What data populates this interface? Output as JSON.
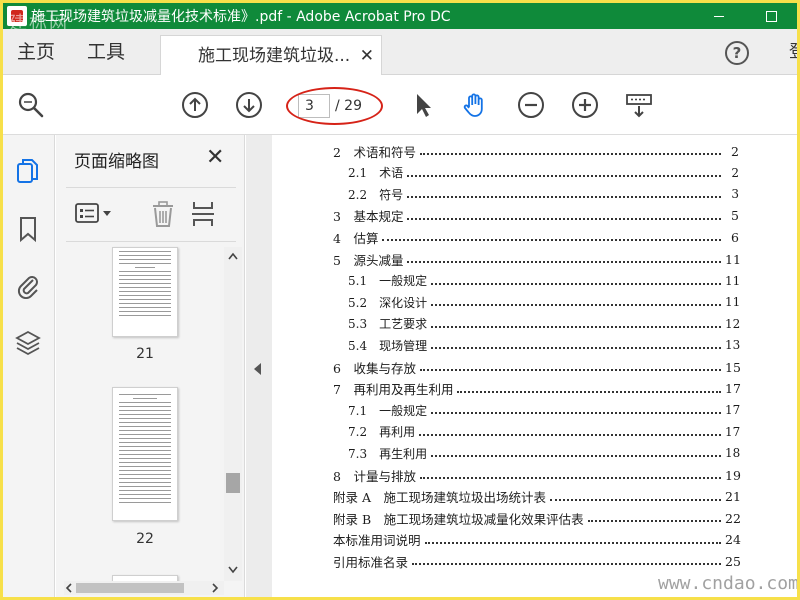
{
  "window": {
    "title": "施工现场建筑垃圾减量化技术标准》.pdf - Adobe Acrobat Pro DC",
    "watermark": "建标网",
    "titlebar_color": "#0f8a3a"
  },
  "tabs": {
    "home": "主页",
    "tools": "工具",
    "document": "施工现场建筑垃圾...",
    "document_close": "✕",
    "help": "?",
    "sign_in": "登"
  },
  "toolbar": {
    "current_page": "3",
    "total_pages": "/ 29",
    "icons": [
      "zoom-search-icon",
      "page-up-icon",
      "page-down-icon",
      "select-arrow-icon",
      "hand-tool-icon",
      "zoom-out-icon",
      "zoom-in-icon",
      "keyboard-scroll-icon"
    ],
    "highlight_color": "#d62318",
    "hand_tool_active_color": "#1473e6"
  },
  "thumbnails": {
    "title": "页面缩略图",
    "close": "✕",
    "pages": [
      {
        "label": "21"
      },
      {
        "label": "22"
      }
    ]
  },
  "toc": [
    {
      "label": "2　术语和符号",
      "page": "2",
      "level": 1
    },
    {
      "label": "2.1　术语",
      "page": "2",
      "level": 2
    },
    {
      "label": "2.2　符号",
      "page": "3",
      "level": 2
    },
    {
      "label": "3　基本规定",
      "page": "5",
      "level": 1
    },
    {
      "label": "4　估算",
      "page": "6",
      "level": 1
    },
    {
      "label": "5　源头减量",
      "page": "11",
      "level": 1
    },
    {
      "label": "5.1　一般规定",
      "page": "11",
      "level": 2
    },
    {
      "label": "5.2　深化设计",
      "page": "11",
      "level": 2
    },
    {
      "label": "5.3　工艺要求",
      "page": "12",
      "level": 2
    },
    {
      "label": "5.4　现场管理",
      "page": "13",
      "level": 2
    },
    {
      "label": "6　收集与存放",
      "page": "15",
      "level": 1
    },
    {
      "label": "7　再利用及再生利用",
      "page": "17",
      "level": 1
    },
    {
      "label": "7.1　一般规定",
      "page": "17",
      "level": 2
    },
    {
      "label": "7.2　再利用",
      "page": "17",
      "level": 2
    },
    {
      "label": "7.3　再生利用",
      "page": "18",
      "level": 2
    },
    {
      "label": "8　计量与排放",
      "page": "19",
      "level": 1
    },
    {
      "label": "附录 A　施工现场建筑垃圾出场统计表",
      "page": "21",
      "level": 1
    },
    {
      "label": "附录 B　施工现场建筑垃圾减量化效果评估表",
      "page": "22",
      "level": 1
    },
    {
      "label": "本标准用词说明",
      "page": "24",
      "level": 1
    },
    {
      "label": "引用标准名录",
      "page": "25",
      "level": 1
    }
  ],
  "footer_watermark": "www.cndao.com"
}
